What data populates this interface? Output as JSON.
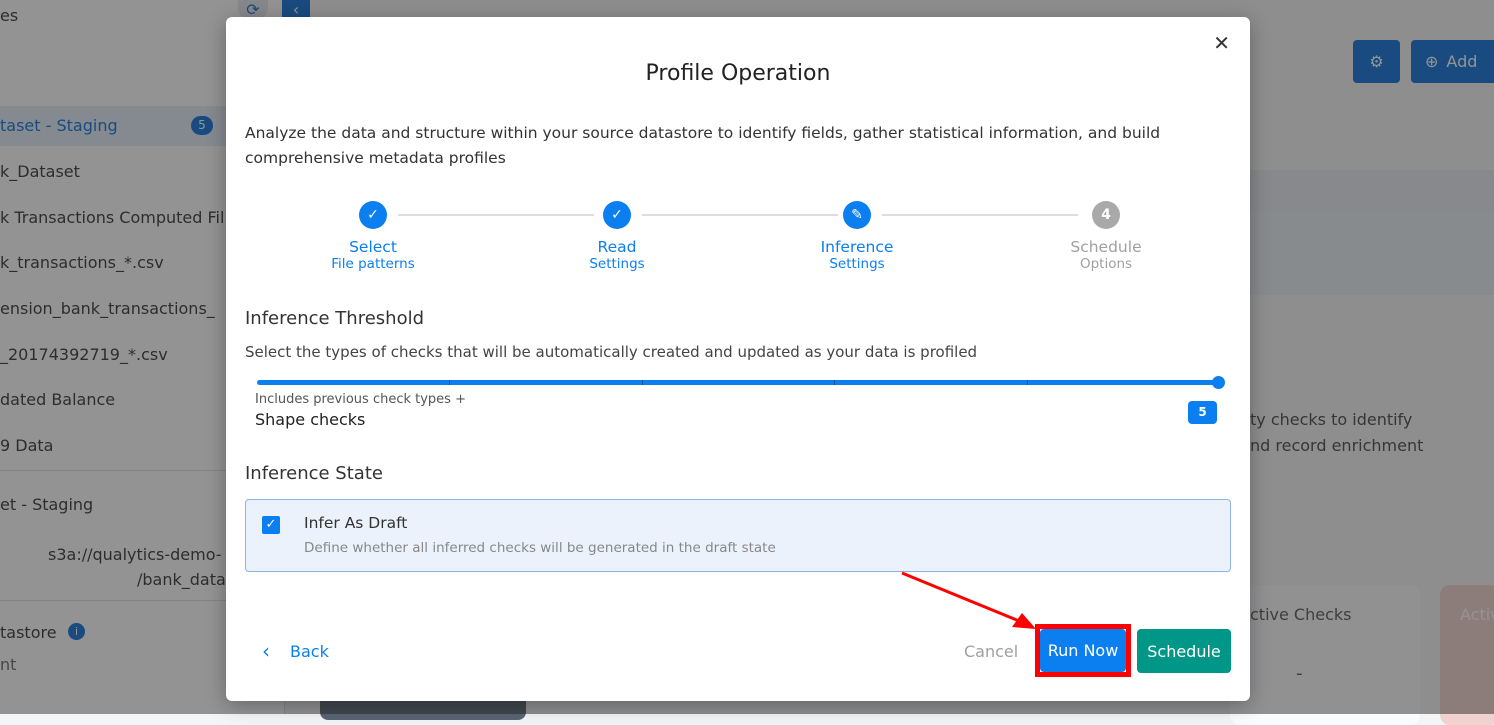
{
  "background": {
    "sidebar": {
      "header_fragment": "es",
      "selected_item": "taset - Staging",
      "selected_badge": "5",
      "items": [
        "k_Dataset",
        "k Transactions Computed Fil",
        "k_transactions_*.csv",
        "ension_bank_transactions_",
        "_20174392719_*.csv",
        "dated Balance",
        "9 Data"
      ],
      "detail_title": "et - Staging",
      "path_line1": "s3a://qualytics-demo-",
      "path_line2": "/bank_data",
      "datastore_label": "tastore",
      "datastore_value": "nt"
    },
    "toolbar": {
      "add_label": "Add"
    },
    "main": {
      "info_line1": "ty checks to identify",
      "info_line2": "nd record enrichment",
      "active_checks_label": "ctive Checks",
      "active_checks_value": "-",
      "active_anomalies_label": "Activ"
    }
  },
  "modal": {
    "title": "Profile Operation",
    "description": "Analyze the data and structure within your source datastore to identify fields, gather statistical information, and build comprehensive metadata profiles",
    "steps": [
      {
        "title": "Select",
        "subtitle": "File patterns",
        "state": "done"
      },
      {
        "title": "Read",
        "subtitle": "Settings",
        "state": "done"
      },
      {
        "title": "Inference",
        "subtitle": "Settings",
        "state": "active"
      },
      {
        "title": "Schedule",
        "subtitle": "Options",
        "state": "pending",
        "number": "4"
      }
    ],
    "threshold": {
      "heading": "Inference Threshold",
      "description": "Select the types of checks that will be automatically created and updated as your data is profiled",
      "value": 5,
      "max": 5,
      "value_label": "5",
      "includes_text": "Includes previous check types +",
      "level_name": "Shape checks"
    },
    "state": {
      "heading": "Inference State",
      "checkbox_label": "Infer As Draft",
      "checkbox_description": "Define whether all inferred checks will be generated in the draft state",
      "checked": true
    },
    "footer": {
      "back": "Back",
      "cancel": "Cancel",
      "run_now": "Run Now",
      "schedule": "Schedule"
    }
  },
  "colors": {
    "primary": "#0b7ff0",
    "schedule": "#009688",
    "highlight": "#ff0000"
  }
}
